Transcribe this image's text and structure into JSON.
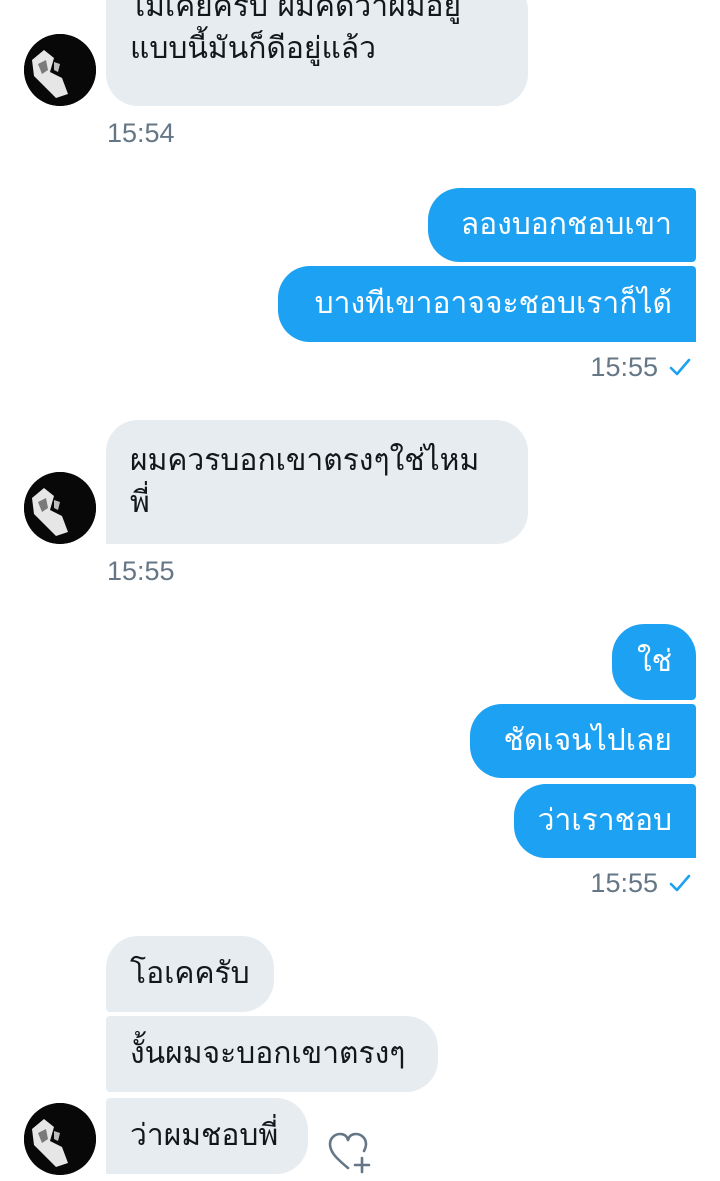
{
  "messages": [
    {
      "id": "m1",
      "lines": [
        "ไม่เคยครับ ผมคิดว่าผมอยู่",
        "แบบนี้มันก็ดีอยู่แล้ว"
      ]
    },
    {
      "id": "m2",
      "text": "ลองบอกชอบเขา"
    },
    {
      "id": "m3",
      "text": "บางทีเขาอาจจะชอบเราก็ได้"
    },
    {
      "id": "m4",
      "lines": [
        "ผมควรบอกเขาตรงๆใช่ไหม",
        "พี่"
      ]
    },
    {
      "id": "m5",
      "text": "ใช่"
    },
    {
      "id": "m6",
      "text": "ชัดเจนไปเลย"
    },
    {
      "id": "m7",
      "text": "ว่าเราชอบ"
    },
    {
      "id": "m8",
      "text": "โอเคครับ"
    },
    {
      "id": "m9",
      "text": "งั้นผมจะบอกเขาตรงๆ"
    },
    {
      "id": "m10",
      "text": "ว่าผมชอบพี่"
    }
  ],
  "timestamps": {
    "t1": "15:54",
    "t2": "15:55",
    "t3": "15:55",
    "t4": "15:55"
  },
  "icons": {
    "read_receipt": "check-icon",
    "react": "heart-plus-icon",
    "avatar": "avatar"
  },
  "colors": {
    "outgoing_bubble": "#1da1f2",
    "incoming_bubble": "#e6ecf0",
    "timestamp": "#657786"
  }
}
